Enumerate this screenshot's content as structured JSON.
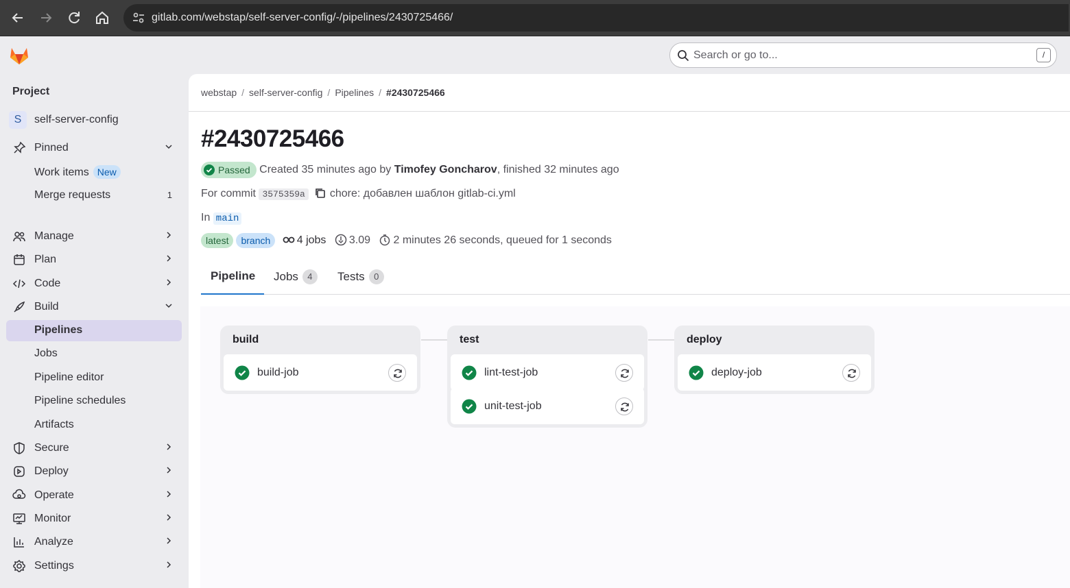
{
  "browser": {
    "url": "gitlab.com/webstap/self-server-config/-/pipelines/2430725466/"
  },
  "header": {
    "search_placeholder": "Search or go to...",
    "search_shortcut": "/"
  },
  "sidebar": {
    "heading": "Project",
    "project_name": "self-server-config",
    "project_initial": "S",
    "pinned": "Pinned",
    "work_items": "Work items",
    "work_items_badge": "New",
    "merge_requests": "Merge requests",
    "merge_requests_count": "1",
    "items": [
      {
        "label": "Manage",
        "icon": "manage-icon"
      },
      {
        "label": "Plan",
        "icon": "plan-icon"
      },
      {
        "label": "Code",
        "icon": "code-icon"
      },
      {
        "label": "Build",
        "icon": "build-icon"
      }
    ],
    "build_sub": [
      "Pipelines",
      "Jobs",
      "Pipeline editor",
      "Pipeline schedules",
      "Artifacts"
    ],
    "lower_items": [
      {
        "label": "Secure",
        "icon": "shield-icon"
      },
      {
        "label": "Deploy",
        "icon": "deploy-icon"
      },
      {
        "label": "Operate",
        "icon": "operate-icon"
      },
      {
        "label": "Monitor",
        "icon": "monitor-icon"
      },
      {
        "label": "Analyze",
        "icon": "analyze-icon"
      },
      {
        "label": "Settings",
        "icon": "settings-icon"
      }
    ]
  },
  "breadcrumb": [
    "webstap",
    "self-server-config",
    "Pipelines",
    "#2430725466"
  ],
  "pipeline": {
    "title": "#2430725466",
    "status": "Passed",
    "created_prefix": "Created 35 minutes ago by",
    "author": "Timofey Goncharov",
    "finished_suffix": ", finished 32 minutes ago",
    "commit_prefix": "For commit",
    "commit_sha": "3575359a",
    "commit_message": "chore: добавлен шаблон gitlab-ci.yml",
    "ref_prefix": "In",
    "ref": "main",
    "tag_latest": "latest",
    "tag_branch": "branch",
    "jobs_count": "4 jobs",
    "compute": "3.09",
    "duration": "2 minutes 26 seconds, queued for 1 seconds"
  },
  "tabs": [
    {
      "label": "Pipeline",
      "count": null
    },
    {
      "label": "Jobs",
      "count": "4"
    },
    {
      "label": "Tests",
      "count": "0"
    }
  ],
  "stages": [
    {
      "name": "build",
      "jobs": [
        "build-job"
      ]
    },
    {
      "name": "test",
      "jobs": [
        "lint-test-job",
        "unit-test-job"
      ]
    },
    {
      "name": "deploy",
      "jobs": [
        "deploy-job"
      ]
    }
  ],
  "colors": {
    "success": "#108548",
    "accent": "#1f75cb",
    "active_nav": "#dad6ee"
  }
}
